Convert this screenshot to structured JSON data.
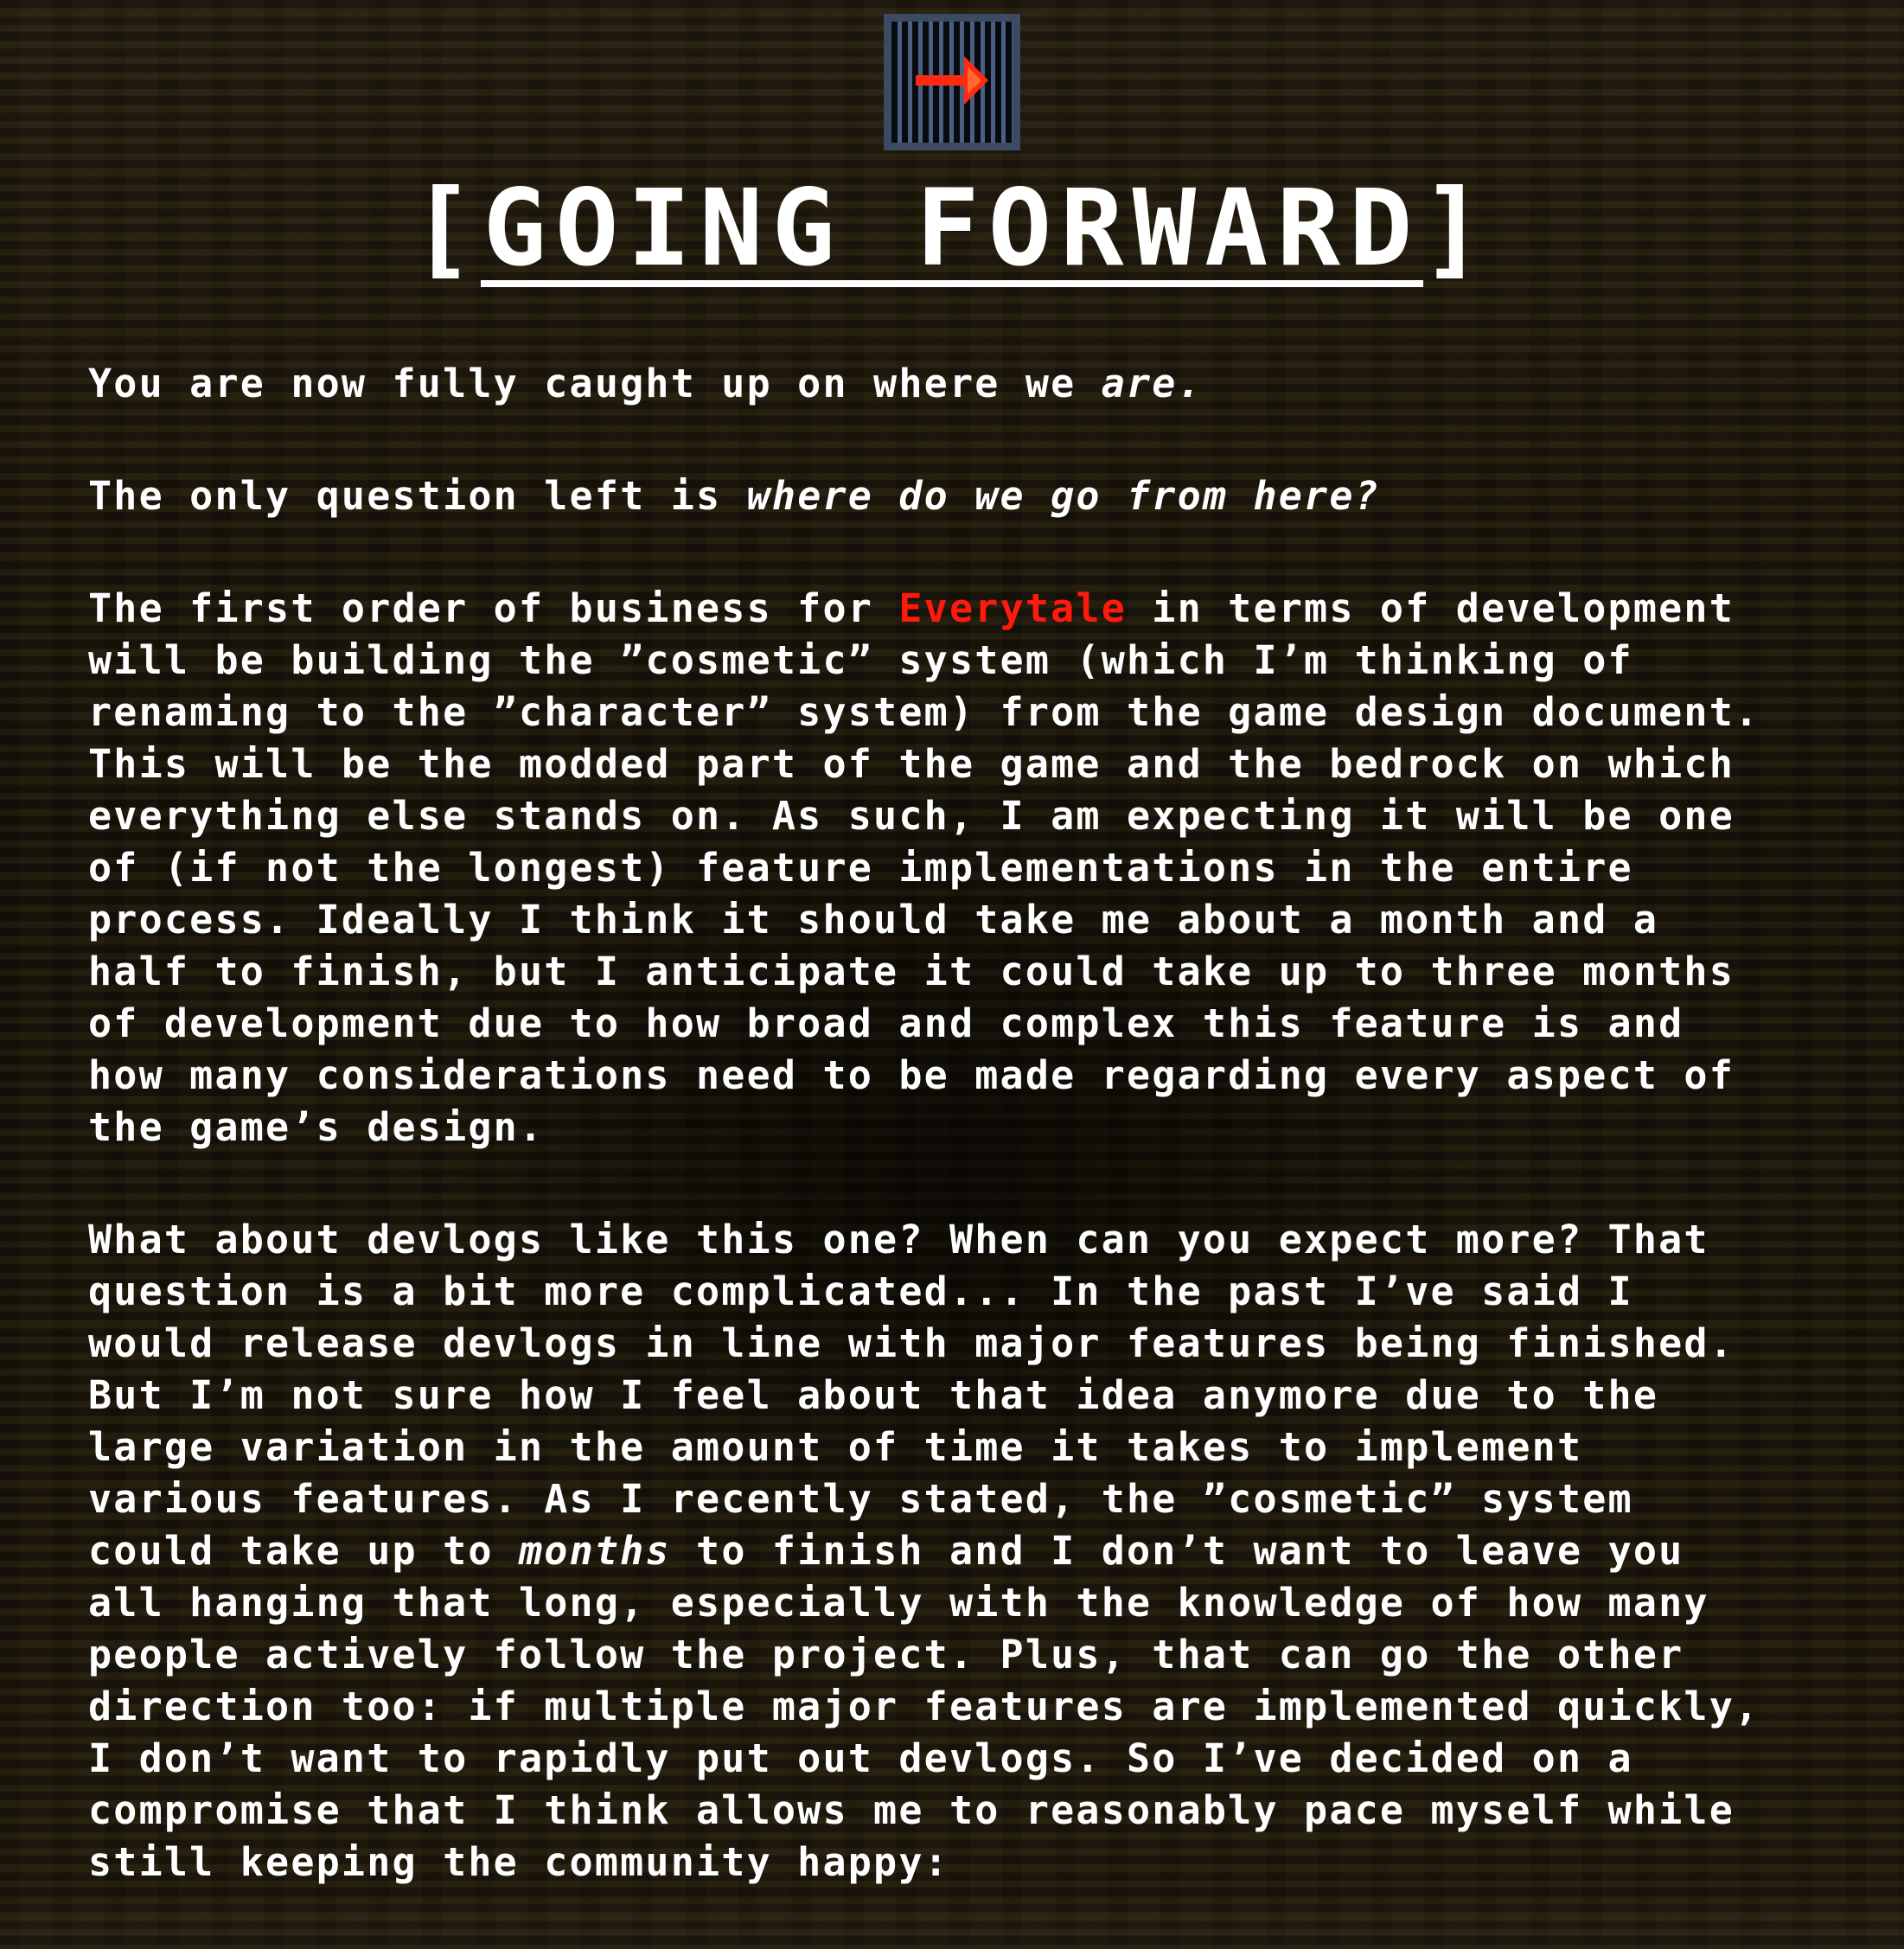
{
  "header": {
    "icon": "exit-arrow-grate-icon",
    "title": "[GOING FORWARD]"
  },
  "colors": {
    "accent": "#ff1a0d",
    "text": "#ffffff",
    "background": "#1b160c",
    "icon_frame": "#3d4a63"
  },
  "paragraphs": {
    "p1": {
      "before": "You are now fully caught up on where we ",
      "em": "are."
    },
    "p2": {
      "before": "The only question left is ",
      "em": "where do we go from here?"
    },
    "p3": {
      "before": "The first order of business for ",
      "brand": "Everytale",
      "after": " in terms of development\nwill be building the ”cosmetic” system (which I’m thinking of\nrenaming to the ”character” system) from the game design document.\nThis will be the modded part of the game and the bedrock on which\neverything else stands on. As such, I am expecting it will be one\nof (if not the longest) feature implementations in the entire\nprocess. Ideally I think it should take me about a month and a\nhalf to finish, but I anticipate it could take up to three months\nof development due to how broad and complex this feature is and\nhow many considerations need to be made regarding every aspect of\nthe game’s design."
    },
    "p4": {
      "before": "What about devlogs like this one? When can you expect more? That\nquestion is a bit more complicated... In the past I’ve said I\nwould release devlogs in line with major features being finished.\nBut I’m not sure how I feel about that idea anymore due to the\nlarge variation in the amount of time it takes to implement\nvarious features. As I recently stated, the ”cosmetic” system\ncould take up to ",
      "em": "months",
      "after": " to finish and I don’t want to leave you\nall hanging that long, especially with the knowledge of how many\npeople actively follow the project. Plus, that can go the other\ndirection too: if multiple major features are implemented quickly,\nI don’t want to rapidly put out devlogs. So I’ve decided on a\ncompromise that I think allows me to reasonably pace myself while\nstill keeping the community happy:"
    }
  }
}
